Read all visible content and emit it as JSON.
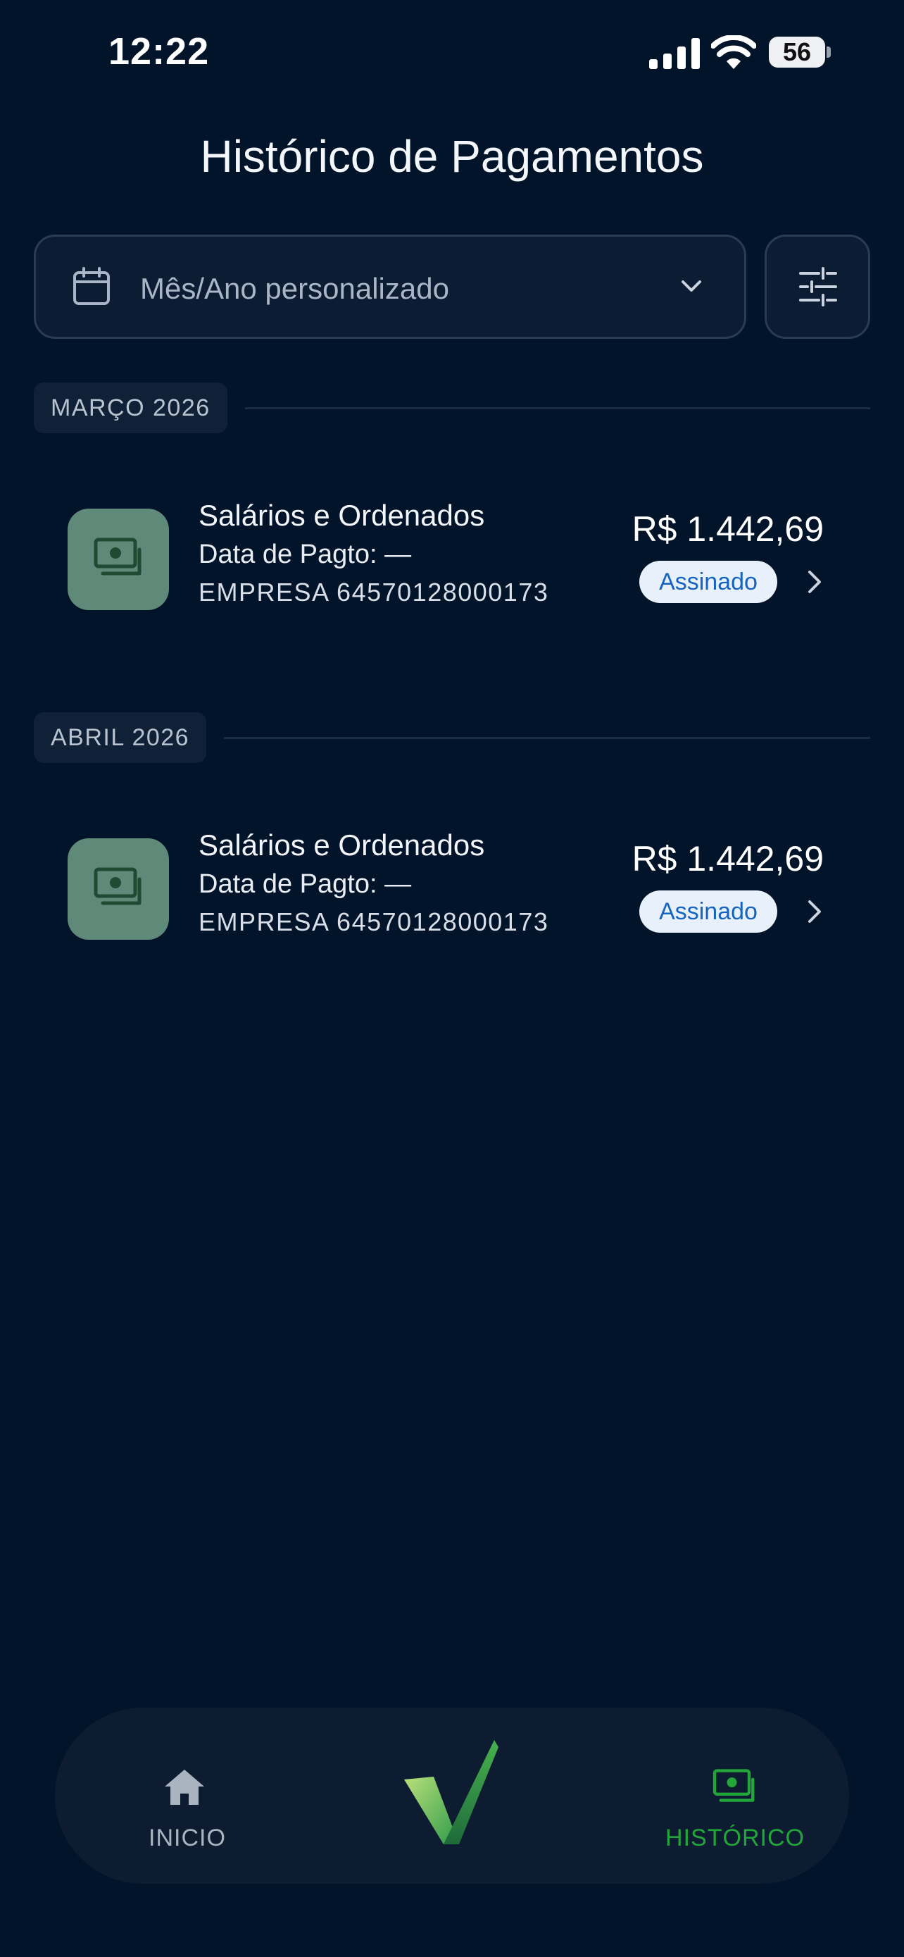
{
  "status_bar": {
    "time": "12:22",
    "battery": "56"
  },
  "page": {
    "title": "Histórico de Pagamentos"
  },
  "filter": {
    "placeholder": "Mês/Ano personalizado"
  },
  "groups": [
    {
      "month": "MARÇO 2026",
      "items": [
        {
          "title": "Salários e Ordenados",
          "date": "Data de Pagto: —",
          "company": "EMPRESA 64570128000173",
          "amount": "R$ 1.442,69",
          "status": "Assinado"
        }
      ]
    },
    {
      "month": "ABRIL 2026",
      "items": [
        {
          "title": "Salários e Ordenados",
          "date": "Data de Pagto: —",
          "company": "EMPRESA 64570128000173",
          "amount": "R$ 1.442,69",
          "status": "Assinado"
        }
      ]
    }
  ],
  "nav": {
    "home_label": "INICIO",
    "history_label": "HISTÓRICO"
  },
  "colors": {
    "background": "#02142a",
    "accent_green": "#22a63a",
    "badge_text": "#1565c0",
    "icon_box": "#5f8a7a"
  },
  "icons": [
    "calendar-icon",
    "chevron-down-icon",
    "sliders-icon",
    "money-icon",
    "chevron-right-icon",
    "home-icon",
    "logo-check",
    "money-icon"
  ]
}
